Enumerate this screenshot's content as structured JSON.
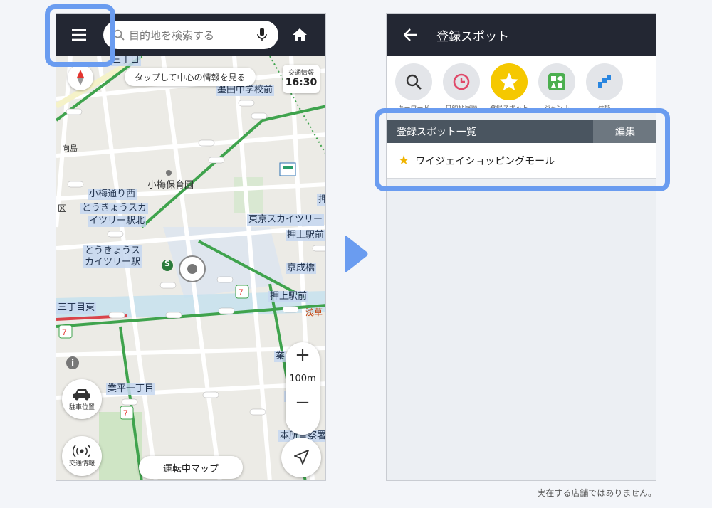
{
  "map_screen": {
    "search_placeholder": "目的地を検索する",
    "hint_text": "タップして中心の情報を見る",
    "traffic_label": "交通情報",
    "traffic_time": "16:30",
    "map_labels": [
      "墨田中学校前",
      "小梅保育園",
      "小梅通り西",
      "とうきょうスカ",
      "イツリー駅北",
      "東京スカイツリー",
      "押上駅前",
      "とうきょうス",
      "カイツリー駅",
      "京成橋",
      "押上駅前",
      "三丁目東",
      "業平一丁目",
      "本所警察署",
      "向島",
      "区",
      "三丁目",
      "押",
      "浅草",
      "業",
      "業"
    ],
    "park_button_label": "駐車位置",
    "traffic_button_label": "交通情報",
    "zoom_plus": "+",
    "zoom_scale": "100m",
    "zoom_minus": "−",
    "bottom_button_label": "運転中マップ",
    "info_icon_label": "i",
    "station_badge": "S"
  },
  "spot_screen": {
    "title": "登録スポット",
    "categories": [
      {
        "label": "キーワード",
        "icon": "search-icon",
        "color": "#e3e5e9"
      },
      {
        "label": "目的地履歴",
        "icon": "clock-icon",
        "color": "#e3e5e9"
      },
      {
        "label": "登録スポット",
        "icon": "star-icon",
        "color": "#f5c800"
      },
      {
        "label": "ジャンル",
        "icon": "genre-icon",
        "color": "#e3e5e9"
      },
      {
        "label": "住所",
        "icon": "address-icon",
        "color": "#e3e5e9"
      }
    ],
    "list_header": "登録スポット一覧",
    "edit_label": "編集",
    "items": [
      {
        "name": "ワイジェイショッピングモール"
      }
    ]
  },
  "footnote": "実在する店舗ではありません。",
  "colors": {
    "highlight": "#6a9cf0",
    "topbar": "#232733",
    "accent_star": "#f0b400"
  }
}
